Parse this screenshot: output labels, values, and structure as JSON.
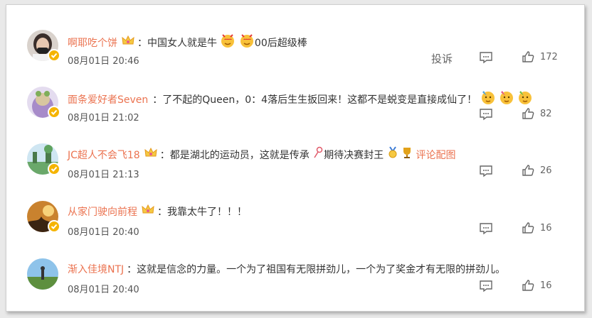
{
  "report_label": "投诉",
  "image_comment_link": "评论配图",
  "comments": [
    {
      "user": "啊耶吃个饼",
      "sep": "：",
      "text": "中国女人就是牛",
      "text2": "00后超级棒",
      "time": "08月01日 20:46",
      "likes": "172"
    },
    {
      "user": "面条爱好者Seven",
      "sep": "：",
      "text": "了不起的Queen，0：4落后生生扳回来！这都不是蜕变是直接成仙了！",
      "time": "08月01日 21:02",
      "likes": "82"
    },
    {
      "user": "JC超人不会飞18",
      "sep": "：",
      "text": "都是湖北的运动员，这就是传承",
      "text2": "期待决赛封王",
      "time": "08月01日 21:13",
      "likes": "26"
    },
    {
      "user": "从家门驶向前程",
      "sep": "：",
      "text": "我靠太牛了！！！",
      "time": "08月01日 20:40",
      "likes": "16"
    },
    {
      "user": "渐入佳境NTJ",
      "sep": "：",
      "text": "这就是信念的力量。一个为了祖国有无限拼劲儿，一个为了奖金才有无限的拼劲儿。",
      "time": "08月01日 20:40",
      "likes": "16"
    }
  ],
  "colors": {
    "username": "#eb7350",
    "text": "#333333",
    "meta": "#555555",
    "badge": "#f5b400"
  },
  "icons": [
    "crown-icon",
    "verified-badge-icon",
    "reply-icon",
    "like-icon",
    "heart-face-emoji",
    "party-face-emoji",
    "pin-icon",
    "medal-icon",
    "trophy-icon"
  ]
}
